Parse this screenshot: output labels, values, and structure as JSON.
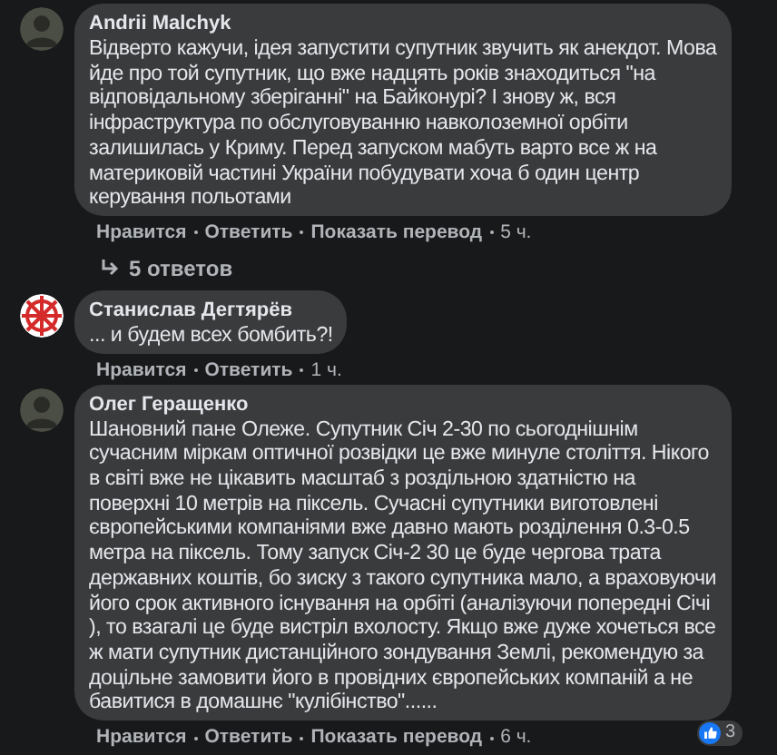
{
  "comments": [
    {
      "author": "Andrii Malchyk",
      "avatar": {
        "kind": "photo"
      },
      "text": "Відверто кажучи, ідея запустити супутник звучить як анекдот. Мова йде про той супутник, що вже надцять років знаходиться \"на відповідальному зберіганні\" на Байконурі? І знову ж, вся інфраструктура по обслуговуванню навколоземної орбіти залишилась у Криму. Перед запуском мабуть варто все ж на материковій частині України побудувати хоча б один центр керування польотами",
      "actions": [
        "Нравится",
        "Ответить",
        "Показать перевод"
      ],
      "time": "5 ч.",
      "replies": "5 ответов"
    },
    {
      "author": "Станислав Дегтярёв",
      "avatar": {
        "kind": "emblem"
      },
      "text": "... и будем всех бомбить?!",
      "actions": [
        "Нравится",
        "Ответить"
      ],
      "time": "1 ч."
    },
    {
      "author": "Олег Геращенко",
      "avatar": {
        "kind": "photo"
      },
      "text": "Шановний пане Олеже. Супутник Січ 2-30 по сьогоднішнім сучасним міркам оптичної розвідки це вже минуле століття. Нікого в світі вже не цікавить масштаб з роздільною здатністю на поверхні 10 метрів на піксель. Сучасні супутники виготовлені європейськими компаніями вже давно мають розділення 0.3-0.5 метра на піксель. Тому запуск Січ-2 30 це буде чергова трата державних коштів, бо зиску з такого супутника мало, а враховуючи його срок активного існування на орбіті (аналізуючи попередні Січі ), то взагалі це буде вистріл вхолосту. Якщо вже дуже хочеться все ж мати супутник дистанційного зондування Землі, рекомендую за доцільне замовити його в провідних європейських компаній а не бавитися в домашнє \"кулібінство\"......",
      "actions": [
        "Нравится",
        "Ответить",
        "Показать перевод"
      ],
      "time": "6 ч.",
      "likes": "3"
    }
  ]
}
